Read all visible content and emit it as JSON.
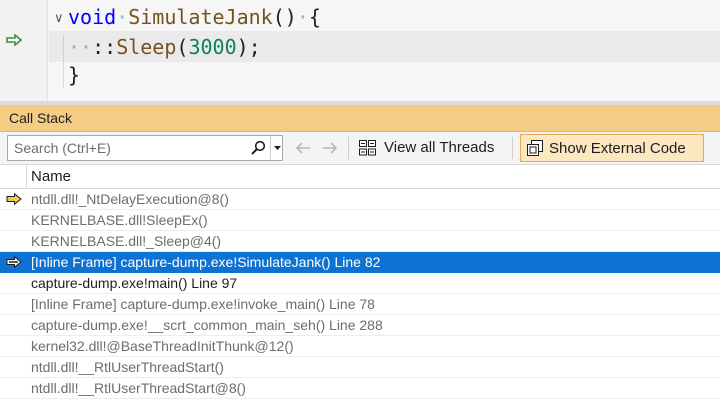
{
  "editor": {
    "line1": {
      "keyword": "void",
      "name": "SimulateJank",
      "rest": "()",
      "brace": "{"
    },
    "line2": {
      "prefix": "::",
      "call": "Sleep",
      "open": "(",
      "number": "3000",
      "close": ");"
    },
    "line3": {
      "text": "}"
    },
    "whitespace_dot": "·"
  },
  "panel": {
    "title": "Call Stack",
    "search_placeholder": "Search (Ctrl+E)",
    "view_threads_label": "View all Threads",
    "show_external_label": "Show External Code",
    "column_name": "Name"
  },
  "frames": [
    {
      "text": "ntdll.dll!_NtDelayExecution@8()",
      "style": "external",
      "marker": "current"
    },
    {
      "text": "KERNELBASE.dll!SleepEx()",
      "style": "external",
      "marker": ""
    },
    {
      "text": "KERNELBASE.dll!_Sleep@4()",
      "style": "external",
      "marker": ""
    },
    {
      "text": "[Inline Frame] capture-dump.exe!SimulateJank() Line 82",
      "style": "selected",
      "marker": "active"
    },
    {
      "text": "capture-dump.exe!main() Line 97",
      "style": "normal",
      "marker": ""
    },
    {
      "text": "[Inline Frame] capture-dump.exe!invoke_main() Line 78",
      "style": "external",
      "marker": ""
    },
    {
      "text": "capture-dump.exe!__scrt_common_main_seh() Line 288",
      "style": "external",
      "marker": ""
    },
    {
      "text": "kernel32.dll!@BaseThreadInitThunk@12()",
      "style": "external",
      "marker": ""
    },
    {
      "text": "ntdll.dll!__RtlUserThreadStart()",
      "style": "external",
      "marker": ""
    },
    {
      "text": "ntdll.dll!__RtlUserThreadStart@8()",
      "style": "external",
      "marker": ""
    }
  ],
  "colors": {
    "panel_title_bg": "#f5cc84",
    "selection": "#0e72d3",
    "current_arrow": "#f0c94d",
    "margin_arrow": "#3f8f3f"
  }
}
